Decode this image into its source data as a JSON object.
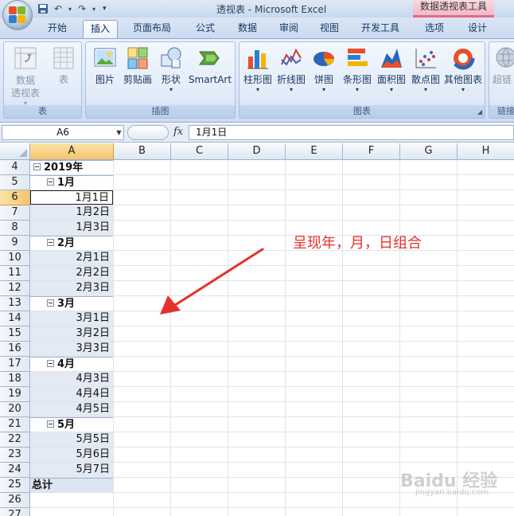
{
  "window": {
    "title": "透视表 - Microsoft Excel",
    "context_tab_group": "数据透视表工具"
  },
  "tabs": [
    "开始",
    "插入",
    "页面布局",
    "公式",
    "数据",
    "审阅",
    "视图",
    "开发工具",
    "选项",
    "设计"
  ],
  "active_tab": "插入",
  "ribbon": {
    "groups": [
      {
        "label": "表",
        "buttons": [
          {
            "label": "数据\n透视表",
            "icon": "pivot-table-icon",
            "enabled": false
          },
          {
            "label": "表",
            "icon": "table-icon",
            "enabled": false
          }
        ]
      },
      {
        "label": "插图",
        "buttons": [
          {
            "label": "图片",
            "icon": "picture-icon"
          },
          {
            "label": "剪贴画",
            "icon": "clip-art-icon"
          },
          {
            "label": "形状",
            "icon": "shapes-icon"
          },
          {
            "label": "SmartArt",
            "icon": "smartart-icon"
          }
        ]
      },
      {
        "label": "图表",
        "buttons": [
          {
            "label": "柱形图",
            "icon": "column-chart-icon"
          },
          {
            "label": "折线图",
            "icon": "line-chart-icon"
          },
          {
            "label": "饼图",
            "icon": "pie-chart-icon"
          },
          {
            "label": "条形图",
            "icon": "bar-chart-icon"
          },
          {
            "label": "面积图",
            "icon": "area-chart-icon"
          },
          {
            "label": "散点图",
            "icon": "scatter-chart-icon"
          },
          {
            "label": "其他图表",
            "icon": "other-charts-icon"
          }
        ]
      },
      {
        "label": "链接",
        "buttons": [
          {
            "label": "超链",
            "icon": "hyperlink-icon"
          }
        ]
      }
    ]
  },
  "formula_bar": {
    "name_box": "A6",
    "fx": "fx",
    "formula": "1月1日"
  },
  "columns": [
    "A",
    "B",
    "C",
    "D",
    "E",
    "F",
    "G",
    "H"
  ],
  "selected_column": "A",
  "rows": [
    {
      "num": "4",
      "text": "2019年",
      "kind": "year"
    },
    {
      "num": "5",
      "text": "1月",
      "kind": "month"
    },
    {
      "num": "6",
      "text": "1月1日",
      "kind": "day",
      "active": true
    },
    {
      "num": "7",
      "text": "1月2日",
      "kind": "day"
    },
    {
      "num": "8",
      "text": "1月3日",
      "kind": "day"
    },
    {
      "num": "9",
      "text": "2月",
      "kind": "month"
    },
    {
      "num": "10",
      "text": "2月1日",
      "kind": "day"
    },
    {
      "num": "11",
      "text": "2月2日",
      "kind": "day"
    },
    {
      "num": "12",
      "text": "2月3日",
      "kind": "day"
    },
    {
      "num": "13",
      "text": "3月",
      "kind": "month"
    },
    {
      "num": "14",
      "text": "3月1日",
      "kind": "day"
    },
    {
      "num": "15",
      "text": "3月2日",
      "kind": "day"
    },
    {
      "num": "16",
      "text": "3月3日",
      "kind": "day"
    },
    {
      "num": "17",
      "text": "4月",
      "kind": "month"
    },
    {
      "num": "18",
      "text": "4月3日",
      "kind": "day"
    },
    {
      "num": "19",
      "text": "4月4日",
      "kind": "day"
    },
    {
      "num": "20",
      "text": "4月5日",
      "kind": "day"
    },
    {
      "num": "21",
      "text": "5月",
      "kind": "month"
    },
    {
      "num": "22",
      "text": "5月5日",
      "kind": "day"
    },
    {
      "num": "23",
      "text": "5月6日",
      "kind": "day"
    },
    {
      "num": "24",
      "text": "5月7日",
      "kind": "day"
    },
    {
      "num": "25",
      "text": "总计",
      "kind": "total"
    },
    {
      "num": "26",
      "text": "",
      "kind": "empty"
    },
    {
      "num": "27",
      "text": "",
      "kind": "empty"
    }
  ],
  "annotation": {
    "text": "呈现年，月，日组合",
    "color": "#e5322d"
  },
  "watermark": {
    "text": "Baidu 经验",
    "sub": "jingyan.baidu.com"
  }
}
